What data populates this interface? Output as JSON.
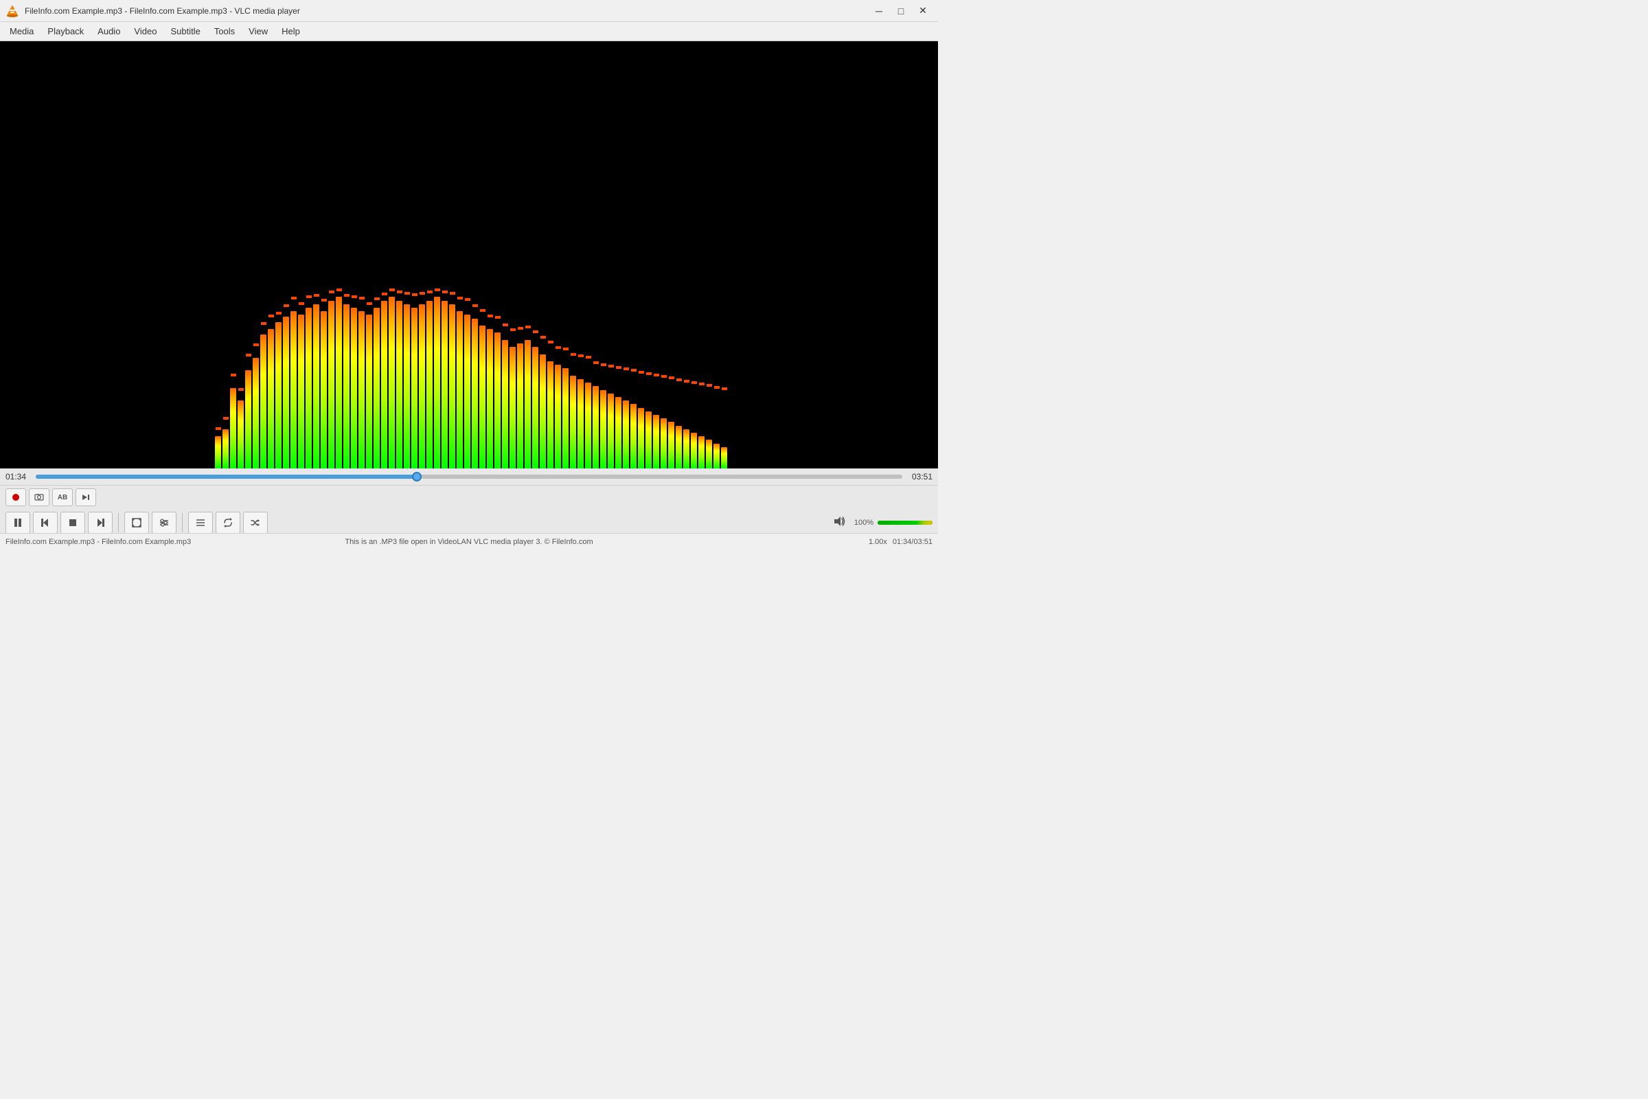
{
  "window": {
    "title": "FileInfo.com Example.mp3 - FileInfo.com Example.mp3 - VLC media player",
    "icon": "vlc-icon"
  },
  "titlebar": {
    "minimize_label": "─",
    "maximize_label": "□",
    "close_label": "✕"
  },
  "menu": {
    "items": [
      {
        "id": "media",
        "label": "Media"
      },
      {
        "id": "playback",
        "label": "Playback"
      },
      {
        "id": "audio",
        "label": "Audio"
      },
      {
        "id": "video",
        "label": "Video"
      },
      {
        "id": "subtitle",
        "label": "Subtitle"
      },
      {
        "id": "tools",
        "label": "Tools"
      },
      {
        "id": "view",
        "label": "View"
      },
      {
        "id": "help",
        "label": "Help"
      }
    ]
  },
  "seekbar": {
    "current_time": "01:34",
    "total_time": "03:51",
    "progress_pct": 44
  },
  "controls": {
    "top": [
      {
        "id": "record",
        "label": "⏺",
        "icon": "record-icon"
      },
      {
        "id": "snapshot",
        "label": "📷",
        "icon": "snapshot-icon"
      },
      {
        "id": "loop-ab",
        "label": "AB",
        "icon": "loop-ab-icon"
      },
      {
        "id": "frame-step",
        "label": "▶|",
        "icon": "frame-step-icon"
      }
    ],
    "bottom": [
      {
        "id": "pause",
        "label": "⏸",
        "icon": "pause-icon"
      },
      {
        "id": "prev",
        "label": "⏮",
        "icon": "prev-icon"
      },
      {
        "id": "stop",
        "label": "⏹",
        "icon": "stop-icon"
      },
      {
        "id": "next",
        "label": "⏭",
        "icon": "next-icon"
      },
      {
        "id": "fullscreen",
        "label": "⛶",
        "icon": "fullscreen-icon"
      },
      {
        "id": "extended",
        "label": "⚙",
        "icon": "extended-icon"
      },
      {
        "id": "playlist",
        "label": "☰",
        "icon": "playlist-icon"
      },
      {
        "id": "loop",
        "label": "🔁",
        "icon": "loop-icon"
      },
      {
        "id": "random",
        "label": "🔀",
        "icon": "random-icon"
      }
    ]
  },
  "volume": {
    "icon": "volume-icon",
    "level_pct": "100%",
    "mute_label": "🔊"
  },
  "statusbar": {
    "left": "FileInfo.com Example.mp3 - FileInfo.com Example.mp3",
    "center": "This is an .MP3 file open in VideoLAN VLC media player 3. © FileInfo.com",
    "speed": "1.00x",
    "time": "01:34/03:51"
  },
  "spectrum": {
    "bars": [
      18,
      22,
      45,
      38,
      55,
      62,
      75,
      78,
      82,
      85,
      88,
      86,
      90,
      92,
      88,
      94,
      96,
      92,
      90,
      88,
      86,
      90,
      94,
      96,
      94,
      92,
      90,
      92,
      94,
      96,
      94,
      92,
      88,
      86,
      84,
      80,
      78,
      76,
      72,
      68,
      70,
      72,
      68,
      64,
      60,
      58,
      56,
      52,
      50,
      48,
      46,
      44,
      42,
      40,
      38,
      36,
      34,
      32,
      30,
      28,
      26,
      24,
      22,
      20,
      18,
      16,
      14,
      12
    ],
    "peak_offsets": [
      5,
      8,
      10,
      8,
      12,
      10,
      8,
      10,
      6,
      8,
      10,
      8,
      8,
      6,
      8,
      6,
      4,
      6,
      8,
      10,
      8,
      6,
      4,
      4,
      6,
      8,
      10,
      8,
      6,
      4,
      6,
      8,
      10,
      12,
      10,
      12,
      10,
      12,
      12,
      14,
      12,
      10,
      12,
      14,
      16,
      14,
      16,
      18,
      20,
      22,
      20,
      22,
      24,
      26,
      28,
      30,
      32,
      34,
      36,
      38,
      40,
      42,
      44,
      46,
      48,
      50,
      52,
      54
    ]
  }
}
